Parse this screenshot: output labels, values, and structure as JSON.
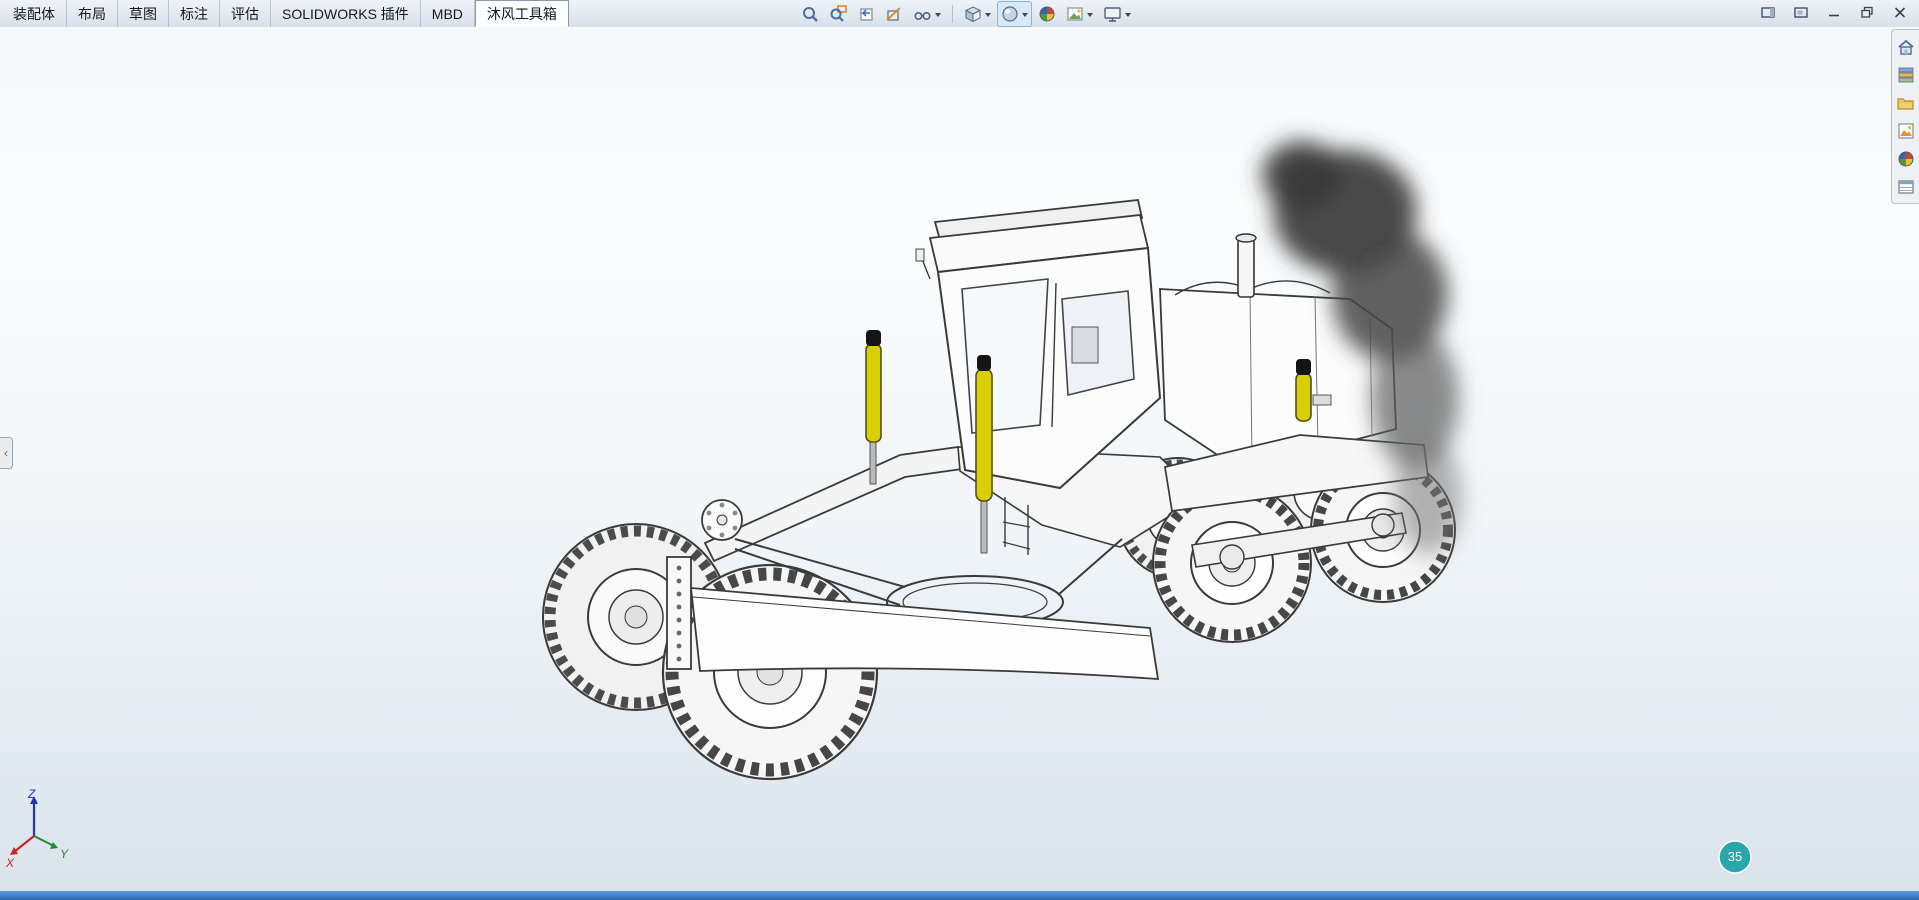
{
  "ribbon": {
    "tabs": [
      {
        "label": "装配体"
      },
      {
        "label": "布局"
      },
      {
        "label": "草图"
      },
      {
        "label": "标注"
      },
      {
        "label": "评估"
      },
      {
        "label": "SOLIDWORKS 插件"
      },
      {
        "label": "MBD"
      },
      {
        "label": "沐风工具箱"
      }
    ]
  },
  "hud_toolbar": {
    "buttons": [
      {
        "name": "zoom-to-fit"
      },
      {
        "name": "zoom-to-area"
      },
      {
        "name": "previous-view"
      },
      {
        "name": "section-view"
      },
      {
        "name": "dynamic-annotation-views"
      },
      {
        "name": "view-orientation"
      },
      {
        "name": "display-style"
      },
      {
        "name": "edit-appearance"
      },
      {
        "name": "apply-scene"
      },
      {
        "name": "view-settings"
      }
    ]
  },
  "window_controls": {
    "items": [
      {
        "name": "dock-window"
      },
      {
        "name": "float-window"
      },
      {
        "name": "minimize"
      },
      {
        "name": "restore"
      },
      {
        "name": "close"
      }
    ]
  },
  "task_pane": {
    "items": [
      {
        "name": "solidworks-resources"
      },
      {
        "name": "design-library"
      },
      {
        "name": "file-explorer"
      },
      {
        "name": "view-palette"
      },
      {
        "name": "appearances-scenes"
      },
      {
        "name": "custom-properties"
      }
    ]
  },
  "left_panel_tab": {
    "glyph": "‹"
  },
  "triad": {
    "x_label": "X",
    "y_label": "Y",
    "z_label": "Z"
  },
  "recorder_badge": {
    "text": "35"
  },
  "colors": {
    "cylinder_yellow": "#d9cf00",
    "badge_teal": "#2aa7ac",
    "accent_blue": "#2f6cb5",
    "triad_x_red": "#cc2222",
    "triad_y_green": "#1f8a2e",
    "triad_z_blue": "#2233bb"
  }
}
